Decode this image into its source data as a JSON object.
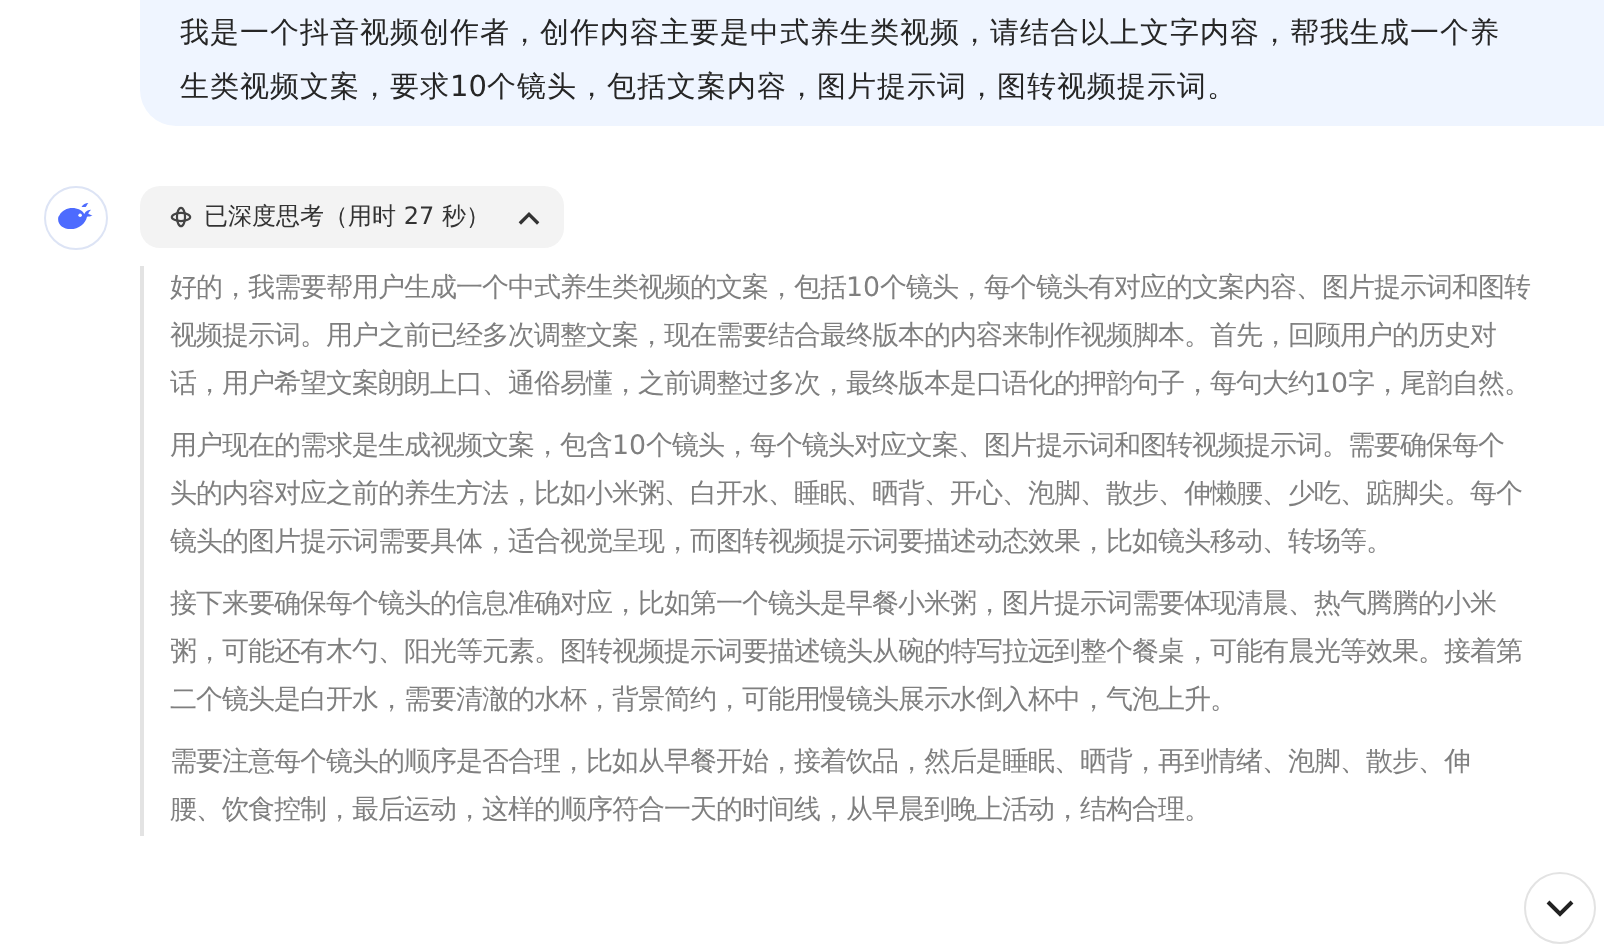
{
  "user_message": {
    "lines": [
      "我是一个抖音视频创作者，创作内容主要是中式养生类视频，请结合以上文字内容，帮我生成一个养",
      "生类视频文案，要求10个镜头，包括文案内容，图片提示词，图转视频提示词。"
    ]
  },
  "thinking_toggle": {
    "label": "已深度思考（用时 27 秒）",
    "expanded": true
  },
  "thinking_paragraphs": [
    {
      "lines": [
        "好的，我需要帮用户生成一个中式养生类视频的文案，包括10个镜头，每个镜头有对应的文案内容、图片提示词和图转",
        "视频提示词。用户之前已经多次调整文案，现在需要结合最终版本的内容来制作视频脚本。首先，回顾用户的历史对",
        "话，用户希望文案朗朗上口、通俗易懂，之前调整过多次，最终版本是口语化的押韵句子，每句大约10字，尾韵自然。"
      ]
    },
    {
      "lines": [
        "用户现在的需求是生成视频文案，包含10个镜头，每个镜头对应文案、图片提示词和图转视频提示词。需要确保每个",
        "头的内容对应之前的养生方法，比如小米粥、白开水、睡眠、晒背、开心、泡脚、散步、伸懒腰、少吃、踮脚尖。每个",
        "镜头的图片提示词需要具体，适合视觉呈现，而图转视频提示词要描述动态效果，比如镜头移动、转场等。"
      ]
    },
    {
      "lines": [
        "接下来要确保每个镜头的信息准确对应，比如第一个镜头是早餐小米粥，图片提示词需要体现清晨、热气腾腾的小米",
        "粥，可能还有木勺、阳光等元素。图转视频提示词要描述镜头从碗的特写拉远到整个餐桌，可能有晨光等效果。接着第",
        "二个镜头是白开水，需要清澈的水杯，背景简约，可能用慢镜头展示水倒入杯中，气泡上升。"
      ]
    },
    {
      "lines": [
        "需要注意每个镜头的顺序是否合理，比如从早餐开始，接着饮品，然后是睡眠、晒背，再到情绪、泡脚、散步、伸",
        "腰、饮食控制，最后运动，这样的顺序符合一天的时间线，从早晨到晚上活动，结构合理。"
      ]
    }
  ]
}
